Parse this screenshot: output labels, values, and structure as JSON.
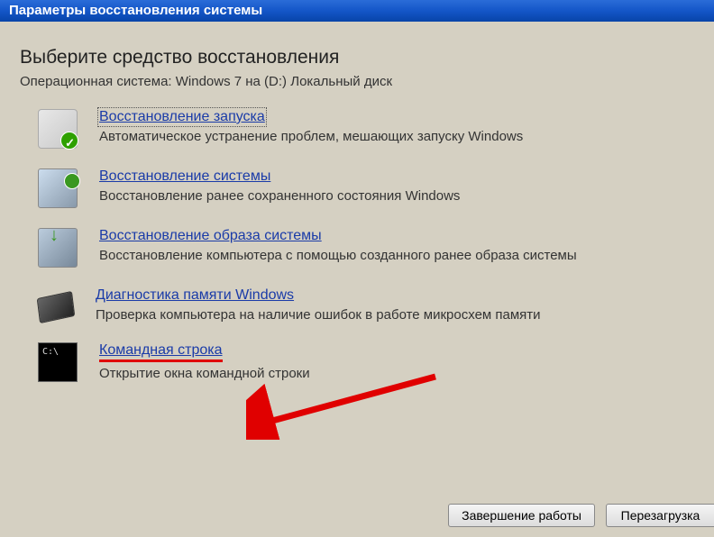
{
  "titlebar": "Параметры восстановления системы",
  "heading": "Выберите средство восстановления",
  "subtext": "Операционная система: Windows 7 на (D:) Локальный диск",
  "options": [
    {
      "title": "Восстановление запуска",
      "desc": "Автоматическое устранение проблем, мешающих запуску Windows"
    },
    {
      "title": "Восстановление системы",
      "desc": "Восстановление ранее сохраненного состояния Windows"
    },
    {
      "title": "Восстановление образа системы",
      "desc": "Восстановление компьютера с помощью  созданного ранее образа системы"
    },
    {
      "title": "Диагностика памяти Windows",
      "desc": "Проверка компьютера на наличие ошибок в работе микросхем памяти"
    },
    {
      "title": "Командная строка",
      "desc": "Открытие окна командной строки"
    }
  ],
  "buttons": {
    "shutdown": "Завершение работы",
    "restart": "Перезагрузка"
  }
}
